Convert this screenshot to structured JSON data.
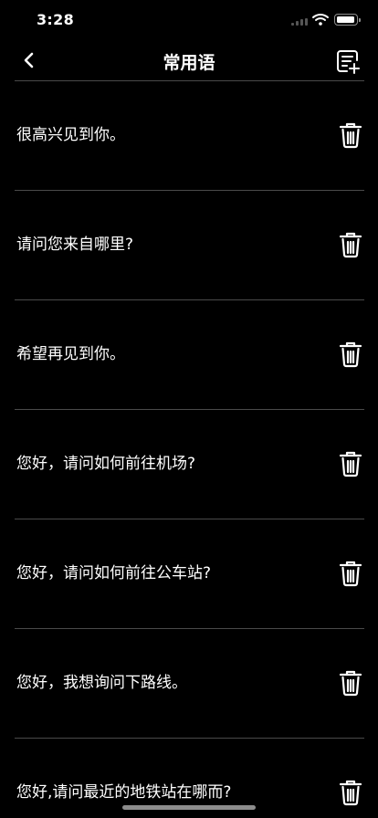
{
  "status_bar": {
    "time": "3:28"
  },
  "nav": {
    "title": "常用语",
    "back_icon": "chevron-left-icon",
    "add_icon": "note-add-icon"
  },
  "phrases": [
    {
      "text": "很高兴见到你。"
    },
    {
      "text": "请问您来自哪里?"
    },
    {
      "text": "希望再见到你。"
    },
    {
      "text": "您好，请问如何前往机场?"
    },
    {
      "text": "您好，请问如何前往公车站?"
    },
    {
      "text": "您好，我想询问下路线。"
    },
    {
      "text": "您好,请问最近的地铁站在哪而?"
    }
  ],
  "row_action": {
    "icon": "trash-icon"
  },
  "colors": {
    "background": "#000000",
    "text": "#ffffff",
    "divider": "#4a4a4a"
  }
}
